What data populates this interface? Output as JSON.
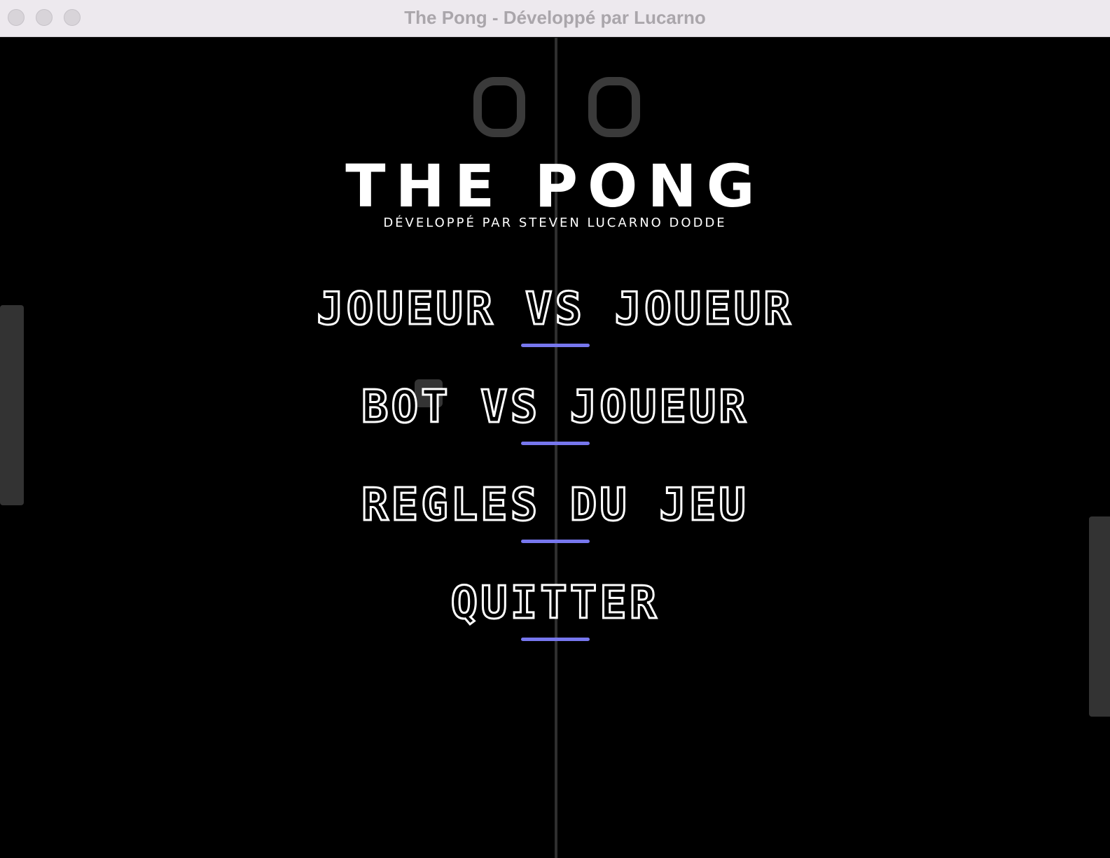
{
  "window": {
    "title": "The Pong - Développé par Lucarno"
  },
  "scoreboard": {
    "left_score": "0",
    "right_score": "0"
  },
  "header": {
    "title": "THE PONG",
    "subtitle": "Développé par Steven Lucarno Dodde"
  },
  "menu": {
    "items": [
      {
        "label": "JOUEUR VS JOUEUR"
      },
      {
        "label": "BOT VS JOUEUR"
      },
      {
        "label": "REGLES DU JEU"
      },
      {
        "label": "QUITTER"
      }
    ]
  },
  "colors": {
    "background": "#000000",
    "accent_underline": "#7777ee",
    "paddle": "#333333",
    "net": "#2f2f2f",
    "text": "#ffffff"
  }
}
